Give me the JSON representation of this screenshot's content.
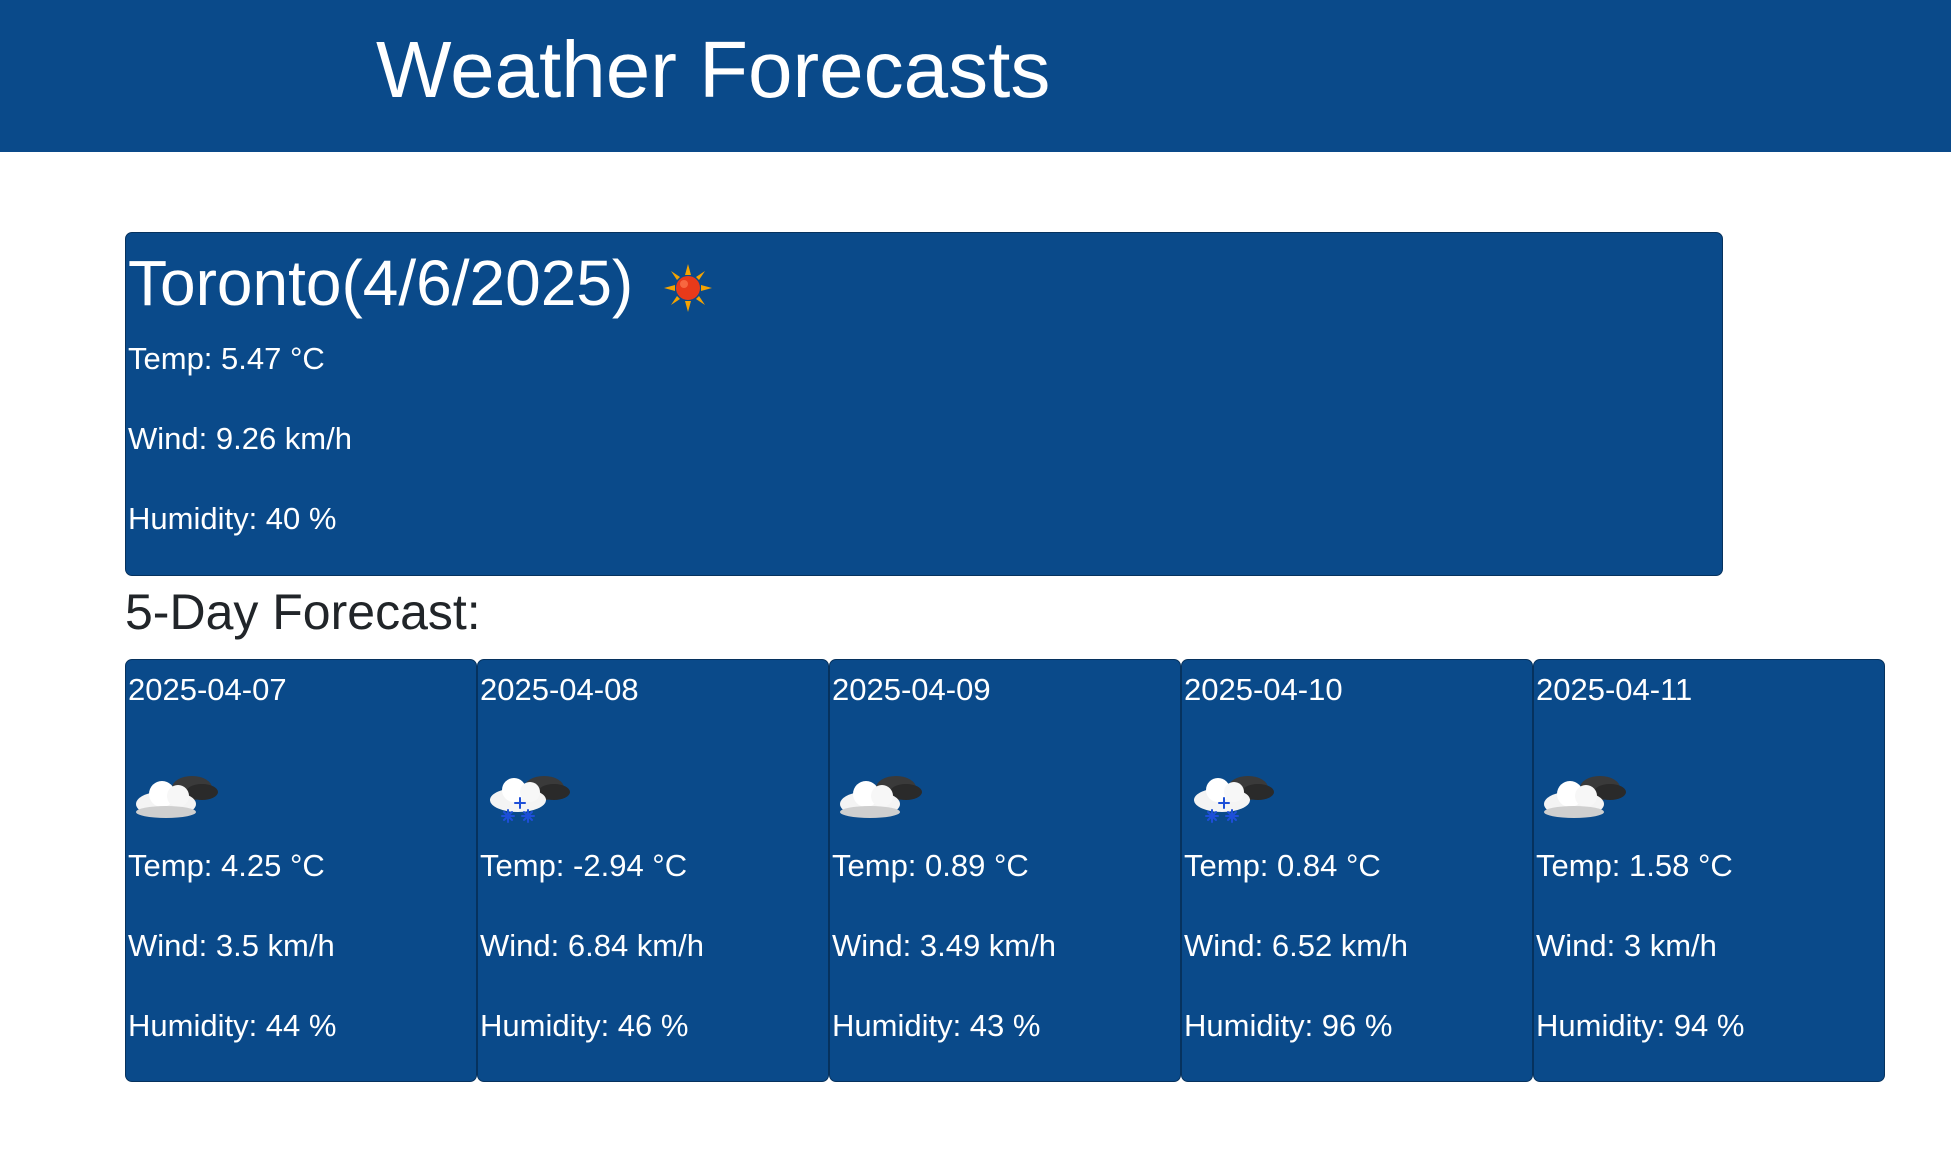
{
  "header": {
    "title": "Weather Forecasts"
  },
  "current": {
    "heading": "Toronto(4/6/2025)",
    "icon": "sun-icon",
    "temp": "Temp: 5.47 °C",
    "wind": "Wind: 9.26 km/h",
    "humidity": "Humidity: 40 %"
  },
  "forecast": {
    "title": "5-Day Forecast:",
    "days": [
      {
        "date": "2025-04-07",
        "icon": "cloud-icon",
        "temp": "Temp: 4.25 °C",
        "wind": "Wind: 3.5 km/h",
        "humidity": "Humidity: 44 %"
      },
      {
        "date": "2025-04-08",
        "icon": "snow-cloud-icon",
        "temp": "Temp: -2.94 °C",
        "wind": "Wind: 6.84 km/h",
        "humidity": "Humidity: 46 %"
      },
      {
        "date": "2025-04-09",
        "icon": "cloud-icon",
        "temp": "Temp: 0.89 °C",
        "wind": "Wind: 3.49 km/h",
        "humidity": "Humidity: 43 %"
      },
      {
        "date": "2025-04-10",
        "icon": "snow-cloud-icon",
        "temp": "Temp: 0.84 °C",
        "wind": "Wind: 6.52 km/h",
        "humidity": "Humidity: 96 %"
      },
      {
        "date": "2025-04-11",
        "icon": "cloud-icon",
        "temp": "Temp: 1.58 °C",
        "wind": "Wind: 3 km/h",
        "humidity": "Humidity: 94 %"
      }
    ]
  },
  "colors": {
    "primary": "#0a4a8a",
    "text_on_primary": "#ffffff"
  }
}
